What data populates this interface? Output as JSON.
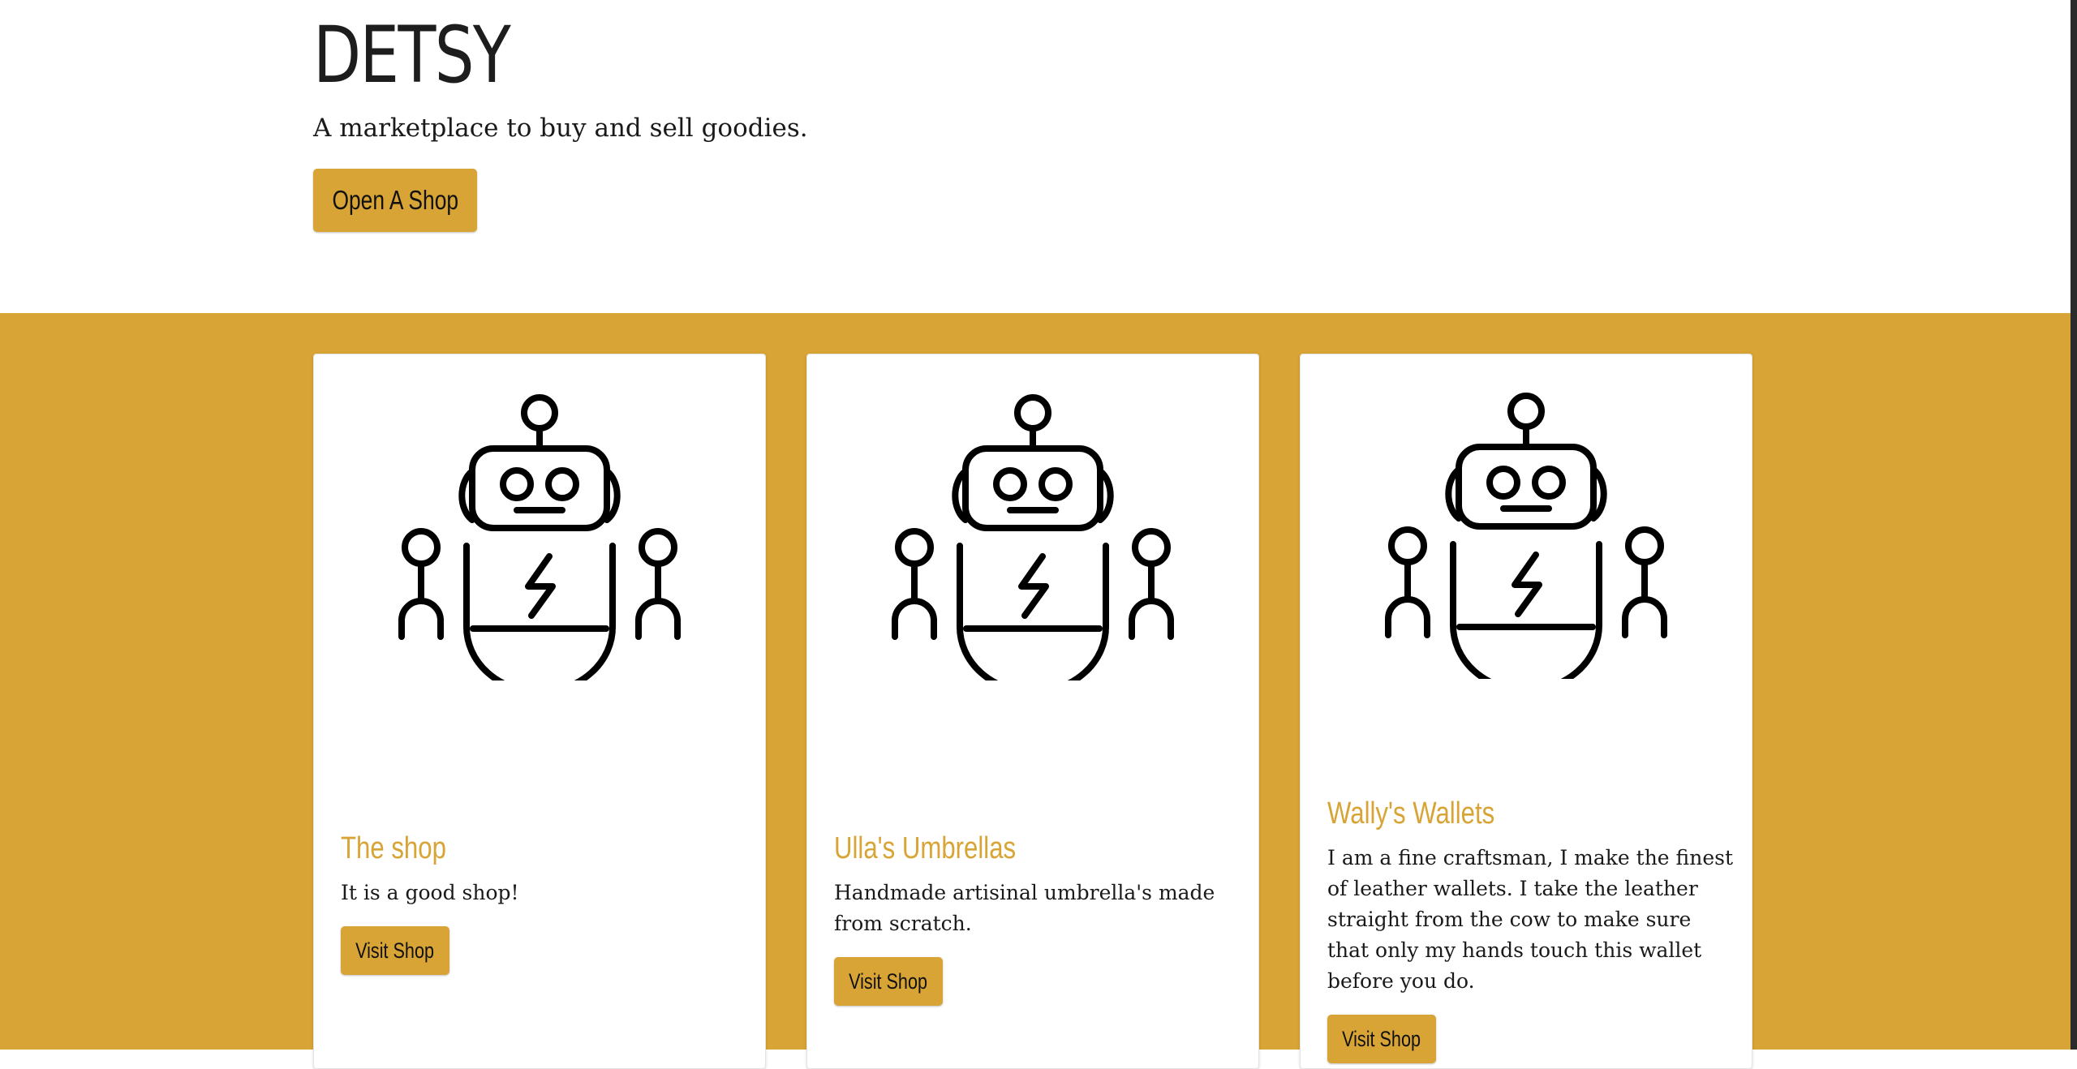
{
  "hero": {
    "brand": "DETSY",
    "tagline": "A marketplace to buy and sell goodies.",
    "open_shop_label": "Open A Shop"
  },
  "colors": {
    "accent": "#d8a435",
    "text": "#1a1a1a",
    "card_bg": "#ffffff"
  },
  "shops": [
    {
      "name": "The shop",
      "description": "It is a good shop!",
      "button_label": "Visit Shop",
      "icon": "robot-icon"
    },
    {
      "name": "Ulla's Umbrellas",
      "description": "Handmade artisinal umbrella's made from scratch.",
      "button_label": "Visit Shop",
      "icon": "robot-icon"
    },
    {
      "name": "Wally's Wallets",
      "description": "I am a fine craftsman, I make the finest of leather wallets. I take the leather straight from the cow to make sure that only my hands touch this wallet before you do.",
      "button_label": "Visit Shop",
      "icon": "robot-icon"
    }
  ]
}
